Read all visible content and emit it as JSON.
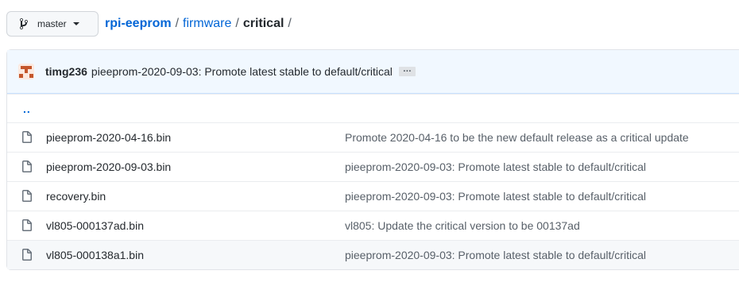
{
  "branch": {
    "label": "master",
    "icon": "git-branch-icon"
  },
  "breadcrumb": {
    "repo": "rpi-eeprom",
    "path": [
      "firmware"
    ],
    "current": "critical",
    "separator": "/"
  },
  "last_commit": {
    "author": "timg236",
    "message": "pieeprom-2020-09-03: Promote latest stable to default/critical",
    "more_label": "…"
  },
  "updir": {
    "label": ".."
  },
  "files": [
    {
      "name": "pieeprom-2020-04-16.bin",
      "commit": "Promote 2020-04-16 to be the new default release as a critical update",
      "icon": "file-icon"
    },
    {
      "name": "pieeprom-2020-09-03.bin",
      "commit": "pieeprom-2020-09-03: Promote latest stable to default/critical",
      "icon": "file-icon"
    },
    {
      "name": "recovery.bin",
      "commit": "pieeprom-2020-09-03: Promote latest stable to default/critical",
      "icon": "file-icon"
    },
    {
      "name": "vl805-000137ad.bin",
      "commit": "vl805: Update the critical version to be 00137ad",
      "icon": "file-icon"
    },
    {
      "name": "vl805-000138a1.bin",
      "commit": "pieeprom-2020-09-03: Promote latest stable to default/critical",
      "icon": "file-icon"
    }
  ],
  "colors": {
    "link": "#0366d6",
    "commit_bar": "#f1f8ff",
    "border": "#e1e4e8"
  }
}
